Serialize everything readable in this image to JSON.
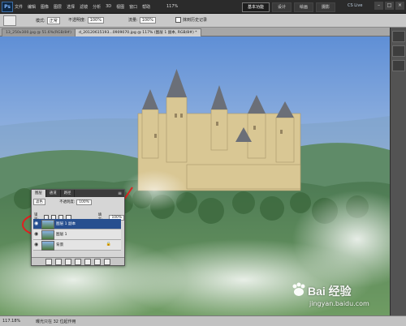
{
  "app": {
    "logo_text": "Ps",
    "menus": [
      "文件",
      "编辑",
      "图像",
      "图层",
      "选择",
      "滤镜",
      "分析",
      "3D",
      "视图",
      "窗口",
      "帮助"
    ],
    "zoom_display": "117%",
    "workspace_buttons": [
      "基本功能",
      "设计",
      "绘画",
      "摄影"
    ],
    "cs_live": "CS Live"
  },
  "options_bar": {
    "mode_label": "模式:",
    "mode_value": "正常",
    "opacity_label": "不透明度:",
    "opacity_value": "100%",
    "flow_label": "流量:",
    "flow_value": "100%",
    "erase_history": "抹到历史记录"
  },
  "document_tabs": [
    {
      "label": "13_250x300.jpg @ 51.6%(RGB/8#)"
    },
    {
      "label": "d_20120615193...0909070.jpg @ 117% (图层 1 副本, RGB/8#) *"
    }
  ],
  "layers_panel": {
    "tabs": [
      "图层",
      "通道",
      "路径"
    ],
    "blend_mode": "滤色",
    "opacity_label": "不透明度:",
    "opacity_value": "100%",
    "lock_label": "锁定:",
    "fill_label": "填充:",
    "fill_value": "100%",
    "layers": [
      {
        "name": "图层 1 副本",
        "selected": true
      },
      {
        "name": "图层 1",
        "selected": false
      },
      {
        "name": "背景",
        "selected": false
      }
    ]
  },
  "status_bar": {
    "zoom": "117.18%",
    "message": "曝光只在 32 位起作用"
  },
  "watermark": {
    "brand": "Bai 经验",
    "url": "jingyan.baidu.com"
  },
  "colors": {
    "annotation_red": "#e02020",
    "selected_layer": "#274f8f",
    "sky": "#6f97d6"
  }
}
